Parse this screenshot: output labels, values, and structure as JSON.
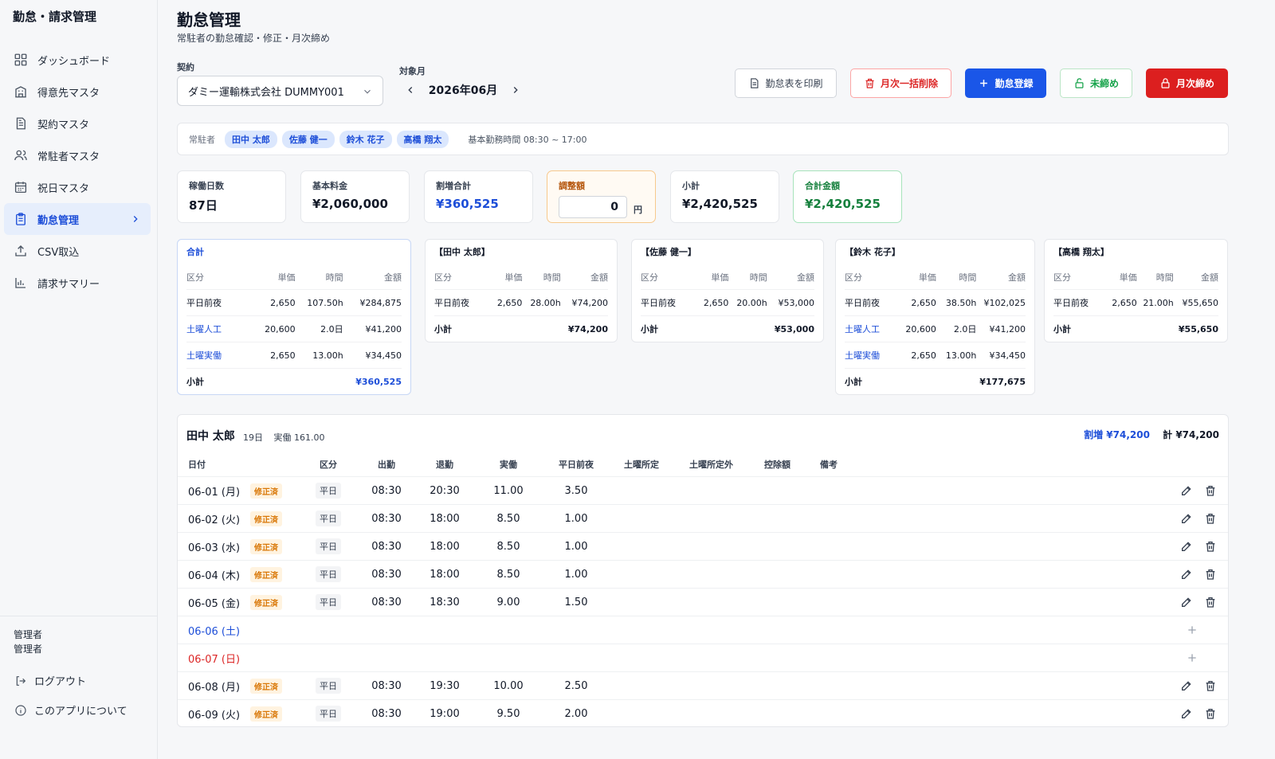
{
  "app": {
    "title": "勤怠・請求管理"
  },
  "sidebar": {
    "items": [
      {
        "label": "ダッシュボード",
        "icon": "dashboard-icon"
      },
      {
        "label": "得意先マスタ",
        "icon": "building-icon"
      },
      {
        "label": "契約マスタ",
        "icon": "document-icon"
      },
      {
        "label": "常駐者マスタ",
        "icon": "users-icon"
      },
      {
        "label": "祝日マスタ",
        "icon": "calendar-icon"
      },
      {
        "label": "勤怠管理",
        "icon": "clipboard-icon",
        "active": true
      },
      {
        "label": "CSV取込",
        "icon": "upload-icon"
      },
      {
        "label": "請求サマリー",
        "icon": "bar-chart-icon"
      }
    ],
    "user_role": "管理者",
    "user_name": "管理者",
    "logout": "ログアウト",
    "about": "このアプリについて"
  },
  "header": {
    "title": "勤怠管理",
    "subtitle": "常駐者の勤怠確認・修正・月次締め"
  },
  "filters": {
    "contract_label": "契約",
    "contract_value": "ダミー運輸株式会社 DUMMY001",
    "month_label": "対象月",
    "month_value": "2026年06月"
  },
  "actions": {
    "print": "勤怠表を印刷",
    "bulk_delete": "月次一括削除",
    "register": "勤怠登録",
    "unclosed": "未締め",
    "close": "月次締め"
  },
  "staff": {
    "label": "常駐者",
    "members": [
      "田中 太郎",
      "佐藤 健一",
      "鈴木 花子",
      "高橋 翔太"
    ],
    "work_hours": "基本勤務時間 08:30 ~ 17:00"
  },
  "stats": {
    "days": {
      "label": "稼働日数",
      "value": "87日"
    },
    "base": {
      "label": "基本料金",
      "value": "¥2,060,000"
    },
    "premium": {
      "label": "割増合計",
      "value": "¥360,525"
    },
    "adjust": {
      "label": "調整額",
      "value": "0",
      "unit": "円"
    },
    "subtotal": {
      "label": "小計",
      "value": "¥2,420,525"
    },
    "total": {
      "label": "合計金額",
      "value": "¥2,420,525"
    }
  },
  "price_headers": {
    "kind": "区分",
    "unit": "単価",
    "time": "時間",
    "amount": "金額",
    "subtotal": "小計"
  },
  "price_cards": [
    {
      "title": "合計",
      "rows": [
        {
          "kind": "平日前夜",
          "unit": "2,650",
          "time": "107.50h",
          "amount": "¥284,875"
        },
        {
          "kind": "土曜人工",
          "unit": "20,600",
          "time": "2.0日",
          "amount": "¥41,200"
        },
        {
          "kind": "土曜実働",
          "unit": "2,650",
          "time": "13.00h",
          "amount": "¥34,450"
        }
      ],
      "subtotal": "¥360,525"
    },
    {
      "title": "【田中 太郎】",
      "rows": [
        {
          "kind": "平日前夜",
          "unit": "2,650",
          "time": "28.00h",
          "amount": "¥74,200"
        }
      ],
      "subtotal": "¥74,200"
    },
    {
      "title": "【佐藤 健一】",
      "rows": [
        {
          "kind": "平日前夜",
          "unit": "2,650",
          "time": "20.00h",
          "amount": "¥53,000"
        }
      ],
      "subtotal": "¥53,000"
    },
    {
      "title": "【鈴木 花子】",
      "rows": [
        {
          "kind": "平日前夜",
          "unit": "2,650",
          "time": "38.50h",
          "amount": "¥102,025"
        },
        {
          "kind": "土曜人工",
          "unit": "20,600",
          "time": "2.0日",
          "amount": "¥41,200"
        },
        {
          "kind": "土曜実働",
          "unit": "2,650",
          "time": "13.00h",
          "amount": "¥34,450"
        }
      ],
      "subtotal": "¥177,675"
    },
    {
      "title": "【高橋 翔太】",
      "rows": [
        {
          "kind": "平日前夜",
          "unit": "2,650",
          "time": "21.00h",
          "amount": "¥55,650"
        }
      ],
      "subtotal": "¥55,650"
    }
  ],
  "detail": {
    "name": "田中 太郎",
    "days": "19日",
    "actual": "実働 161.00",
    "premium": "割増 ¥74,200",
    "total": "計 ¥74,200",
    "columns": {
      "date": "日付",
      "kind": "区分",
      "in": "出勤",
      "out": "退勤",
      "work": "実働",
      "pre": "平日前夜",
      "sat1": "土曜所定",
      "sat2": "土曜所定外",
      "ded": "控除額",
      "note": "備考"
    },
    "rows": [
      {
        "date": "06-01 (月)",
        "badge": "修正済",
        "kind": "平日",
        "in": "08:30",
        "out": "20:30",
        "work": "11.00",
        "pre": "3.50"
      },
      {
        "date": "06-02 (火)",
        "badge": "修正済",
        "kind": "平日",
        "in": "08:30",
        "out": "18:00",
        "work": "8.50",
        "pre": "1.00"
      },
      {
        "date": "06-03 (水)",
        "badge": "修正済",
        "kind": "平日",
        "in": "08:30",
        "out": "18:00",
        "work": "8.50",
        "pre": "1.00"
      },
      {
        "date": "06-04 (木)",
        "badge": "修正済",
        "kind": "平日",
        "in": "08:30",
        "out": "18:00",
        "work": "8.50",
        "pre": "1.00"
      },
      {
        "date": "06-05 (金)",
        "badge": "修正済",
        "kind": "平日",
        "in": "08:30",
        "out": "18:30",
        "work": "9.00",
        "pre": "1.50"
      },
      {
        "date": "06-06 (土)",
        "empty": true,
        "day_type": "sat"
      },
      {
        "date": "06-07 (日)",
        "empty": true,
        "day_type": "sun"
      },
      {
        "date": "06-08 (月)",
        "badge": "修正済",
        "kind": "平日",
        "in": "08:30",
        "out": "19:30",
        "work": "10.00",
        "pre": "2.50"
      },
      {
        "date": "06-09 (火)",
        "badge": "修正済",
        "kind": "平日",
        "in": "08:30",
        "out": "19:00",
        "work": "9.50",
        "pre": "2.00"
      }
    ]
  },
  "colors": {
    "primary": "#1a56e8",
    "danger": "#dc1f1f",
    "success": "#16a34a",
    "warning": "#d97706",
    "link": "#1d4ed8"
  }
}
